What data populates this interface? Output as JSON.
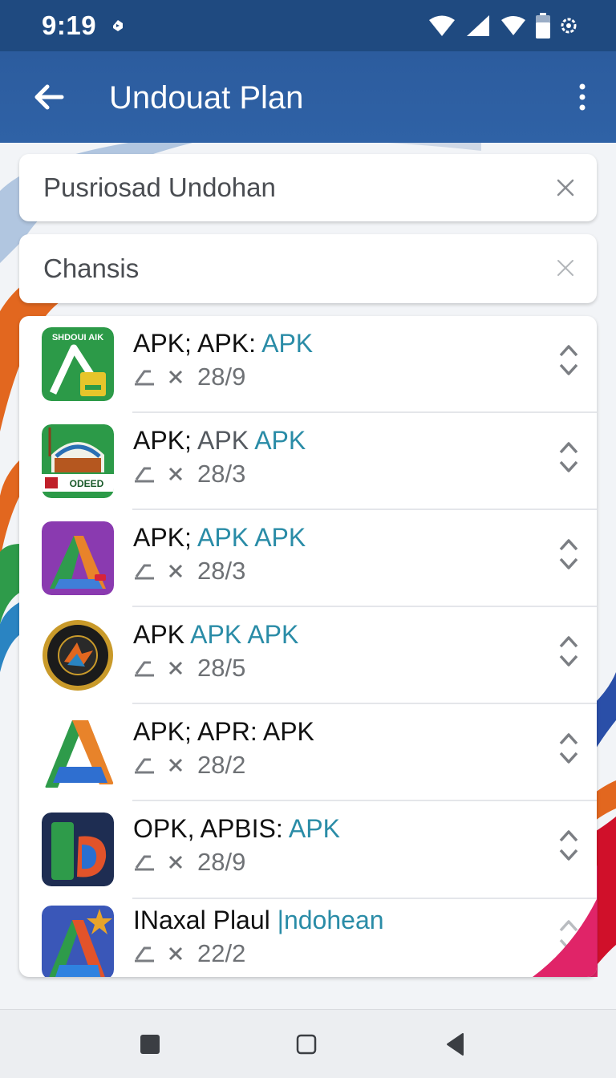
{
  "status_bar": {
    "time": "9:19"
  },
  "app_bar": {
    "title": "Undouat Plan"
  },
  "search": {
    "primary_value": "Pusriosad Undohan",
    "secondary_value": "Chansis"
  },
  "list": {
    "items": [
      {
        "title_black": "APK; APK: ",
        "title_teal": "APK",
        "value": "28/9",
        "icon_label": "SHDOUI AIK",
        "icon": "green-triangle-app-icon"
      },
      {
        "title_black": "APK; ",
        "title_gray": "APK ",
        "title_teal": "APK",
        "value": "28/3",
        "icon_label": "ODEED",
        "icon": "stadium-app-icon"
      },
      {
        "title_black": "APK; ",
        "title_teal": "APK APK",
        "value": "28/3",
        "icon": "purple-triangle-app-icon"
      },
      {
        "title_black": "APK ",
        "title_teal": "APK APK",
        "value": "28/5",
        "icon": "gold-badge-app-icon"
      },
      {
        "title_black": "APK; APR: APK",
        "title_teal": "",
        "value": "28/2",
        "icon": "orange-green-triangle-app-icon"
      },
      {
        "title_black": "OPK, APBIS: ",
        "title_teal": "APK",
        "value": "28/9",
        "icon": "navy-b-app-icon"
      },
      {
        "title_black": "INaxal Plaul ",
        "title_teal": "|ndohean",
        "value": "22/2",
        "icon": "blue-star-triangle-app-icon"
      }
    ]
  },
  "colors": {
    "status_bar": "#1f4a80",
    "app_bar": "#2f62a6",
    "accent_teal": "#2a8ca7"
  }
}
